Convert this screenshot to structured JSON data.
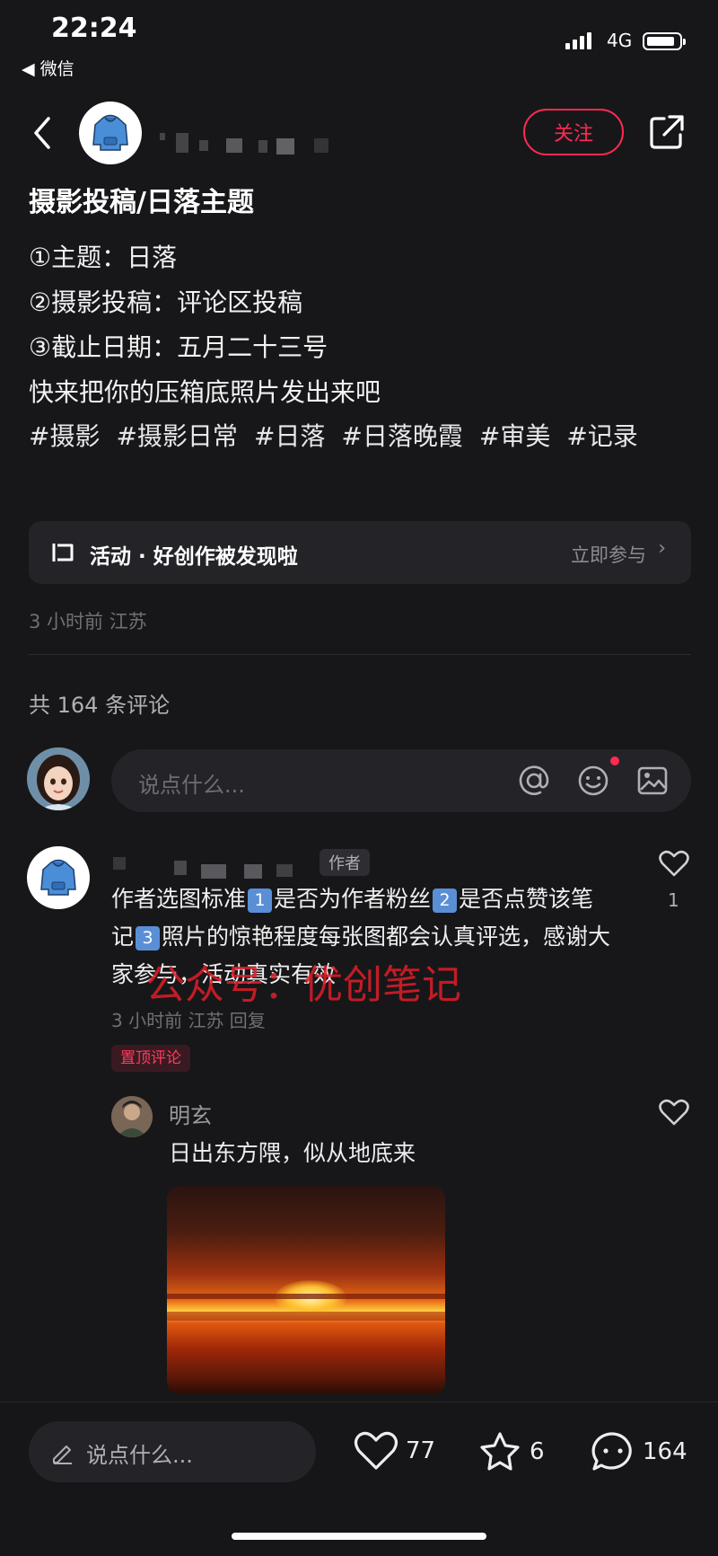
{
  "status_bar": {
    "time": "22:24",
    "back_app": "◀ 微信",
    "network": "4G"
  },
  "header": {
    "username_masked": "",
    "follow_label": "关注"
  },
  "post": {
    "title": "摄影投稿/日落主题",
    "lines": [
      "①主题：日落",
      "②摄影投稿：评论区投稿",
      "③截止日期：五月二十三号",
      "快来把你的压箱底照片发出来吧"
    ],
    "tags": [
      "#摄影",
      "#摄影日常",
      "#日落",
      "#日落晚霞",
      "#审美",
      "#记录"
    ],
    "activity": {
      "label": "活动 · 好创作被发现啦",
      "cta": "立即参与"
    },
    "meta": "3 小时前 江苏"
  },
  "comments_section": {
    "count_label": "共 164 条评论",
    "input_placeholder": "说点什么..."
  },
  "pinned_comment": {
    "author_badge": "作者",
    "text_parts": [
      "作者选图标准",
      "是否为作者粉丝",
      "是否点赞该笔记",
      "照片的惊艳程度每张图都会认真评选，感谢大家参与，活动真实有效"
    ],
    "badges": [
      "1",
      "2",
      "3"
    ],
    "meta": "3 小时前 江苏 回复",
    "pinned_label": "置顶评论",
    "likes": "1",
    "watermark": "公众号：优创笔记"
  },
  "reply": {
    "name": "明玄",
    "text": "日出东方隈，似从地底来"
  },
  "bottom_bar": {
    "placeholder": "说点什么...",
    "likes": "77",
    "stars": "6",
    "comments": "164"
  },
  "colors": {
    "accent": "#ff2a52",
    "background": "#17171a",
    "card": "#242428"
  },
  "icons": [
    "back-icon",
    "share-icon",
    "at-icon",
    "emoji-icon",
    "image-icon",
    "heart-icon",
    "star-icon",
    "comment-icon",
    "pencil-icon",
    "chevron-right-icon",
    "activity-icon"
  ]
}
